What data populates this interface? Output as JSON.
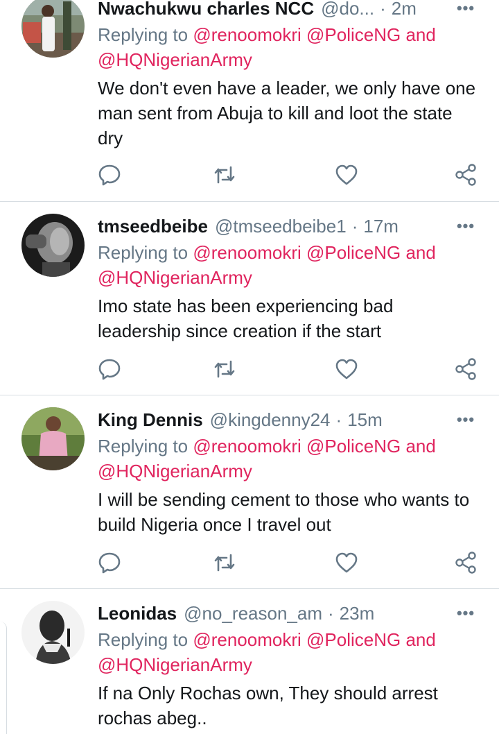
{
  "tweets": [
    {
      "name": "Nwachukwu charles NCC",
      "handle": "@do...",
      "time": "2m",
      "replying_prefix": "Replying to ",
      "mention1": "@renoomokri",
      "mention2": "@PoliceNG",
      "and_word": " and",
      "mention3": "@HQNigerianArmy",
      "text": "We don't even have a leader, we only have one man sent from Abuja to kill and loot the state dry",
      "more_icon": "more-dots-icon"
    },
    {
      "name": "tmseedbeibe",
      "handle": "@tmseedbeibe1",
      "time": "17m",
      "replying_prefix": "Replying to ",
      "mention1": "@renoomokri",
      "mention2": "@PoliceNG",
      "and_word": " and",
      "mention3": "@HQNigerianArmy",
      "text": "Imo state has been experiencing bad leadership since creation if the start",
      "more_icon": "more-dots-icon"
    },
    {
      "name": "King Dennis",
      "handle": "@kingdenny24",
      "time": "15m",
      "replying_prefix": "Replying to ",
      "mention1": "@renoomokri",
      "mention2": "@PoliceNG",
      "and_word": " and",
      "mention3": "@HQNigerianArmy",
      "text": "I will be sending cement to those who wants to build Nigeria once I travel out",
      "more_icon": "more-dots-icon"
    },
    {
      "name": "Leonidas",
      "handle": "@no_reason_am",
      "time": "23m",
      "replying_prefix": "Replying to ",
      "mention1": "@renoomokri",
      "mention2": "@PoliceNG",
      "and_word": " and",
      "mention3": "@HQNigerianArmy",
      "text": "If na Only Rochas own,  They should arrest rochas abeg..",
      "more_icon": "more-dots-icon"
    }
  ],
  "separator": "·",
  "more_glyph": "•••",
  "icons": {
    "reply": "reply-bubble-icon",
    "retweet": "retweet-icon",
    "like": "heart-icon",
    "share": "share-icon"
  },
  "colors": {
    "mention": "#e0245e",
    "secondary_text": "#657786",
    "primary_text": "#14171a",
    "divider": "#d7dde2"
  }
}
